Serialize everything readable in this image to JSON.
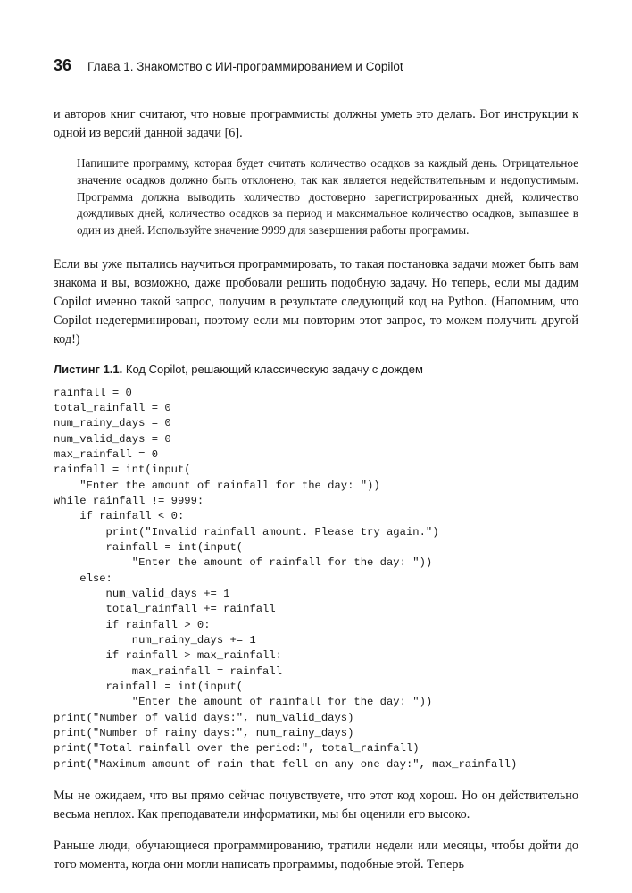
{
  "header": {
    "page_number": "36",
    "chapter": "Глава 1. Знакомство с ИИ-программированием и Copilot"
  },
  "paragraphs": {
    "p1": "и авторов книг считают, что новые программисты должны уметь это делать. Вот инструкции к одной из версий данной задачи [6].",
    "blockquote": "Напишите программу, которая будет считать количество осадков за каждый день. Отрицательное значение осадков должно быть отклонено, так как является недействительным и недопустимым. Программа должна выводить количество достоверно зарегистрированных дней, количество дождливых дней, количество осадков за период и максимальное количество осадков, выпавшее в один из дней. Используйте значение 9999 для завершения работы программы.",
    "p2": "Если вы уже пытались научиться программировать, то такая постановка задачи может быть вам знакома и вы, возможно, даже пробовали решить подобную задачу. Но теперь, если мы дадим Copilot именно такой запрос, получим в результате следующий код на Python. (Напомним, что Copilot недетерминирован, поэтому если мы повторим этот запрос, то можем получить другой код!)",
    "p3": "Мы не ожидаем, что вы прямо сейчас почувствуете, что этот код хорош. Но он действительно весьма неплох. Как преподаватели информатики, мы бы оценили его высоко.",
    "p4": "Раньше люди, обучающиеся программированию, тратили недели или месяцы, чтобы дойти до того момента, когда они могли написать программы, подобные этой. Теперь"
  },
  "listing": {
    "label": "Листинг 1.1.",
    "title": " Код Copilot, решающий классическую задачу с дождем",
    "code": "rainfall = 0\ntotal_rainfall = 0\nnum_rainy_days = 0\nnum_valid_days = 0\nmax_rainfall = 0\nrainfall = int(input(\n    \"Enter the amount of rainfall for the day: \"))\nwhile rainfall != 9999:\n    if rainfall < 0:\n        print(\"Invalid rainfall amount. Please try again.\")\n        rainfall = int(input(\n            \"Enter the amount of rainfall for the day: \"))\n    else:\n        num_valid_days += 1\n        total_rainfall += rainfall\n        if rainfall > 0:\n            num_rainy_days += 1\n        if rainfall > max_rainfall:\n            max_rainfall = rainfall\n        rainfall = int(input(\n            \"Enter the amount of rainfall for the day: \"))\nprint(\"Number of valid days:\", num_valid_days)\nprint(\"Number of rainy days:\", num_rainy_days)\nprint(\"Total rainfall over the period:\", total_rainfall)\nprint(\"Maximum amount of rain that fell on any one day:\", max_rainfall)"
  }
}
